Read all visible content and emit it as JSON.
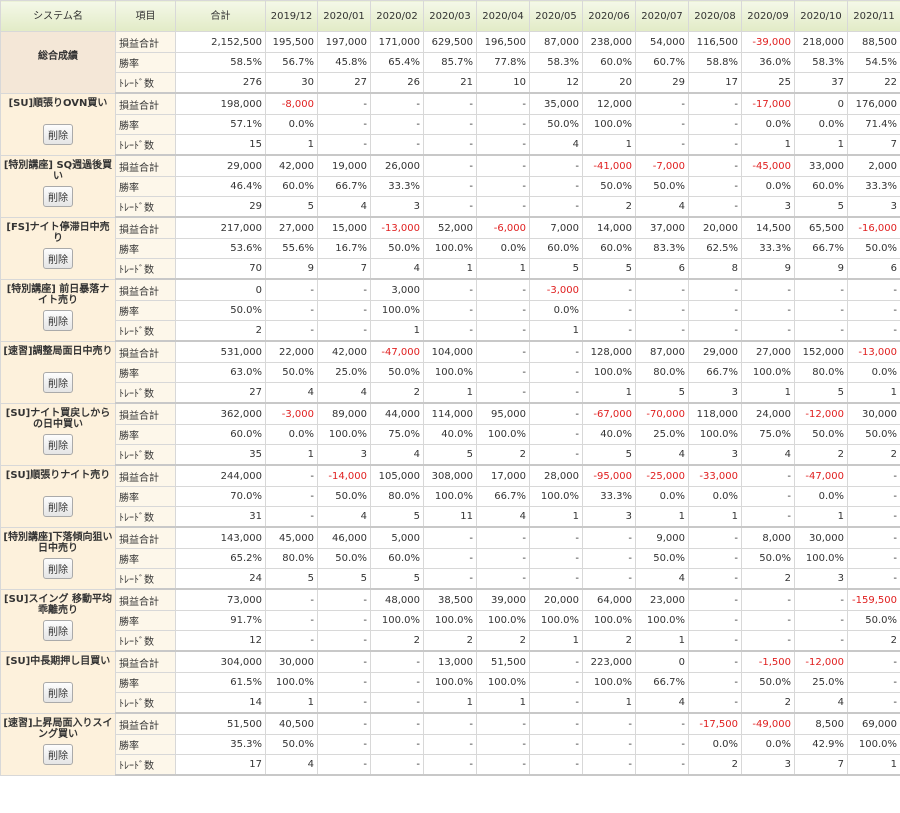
{
  "header": {
    "system": "システム名",
    "item": "項目",
    "total": "合計",
    "months": [
      "2019/12",
      "2020/01",
      "2020/02",
      "2020/03",
      "2020/04",
      "2020/05",
      "2020/06",
      "2020/07",
      "2020/08",
      "2020/09",
      "2020/10",
      "2020/11"
    ]
  },
  "row_labels": [
    "損益合計",
    "勝率",
    "ﾄﾚｰﾄﾞ数"
  ],
  "delete_label": "削除",
  "groups": [
    {
      "name": "総合成績",
      "is_total": true,
      "profit": [
        "2,152,500",
        "195,500",
        "197,000",
        "171,000",
        "629,500",
        "196,500",
        "87,000",
        "238,000",
        "54,000",
        "116,500",
        "-39,000",
        "218,000",
        "88,500"
      ],
      "winrate": [
        "58.5%",
        "56.7%",
        "45.8%",
        "65.4%",
        "85.7%",
        "77.8%",
        "58.3%",
        "60.0%",
        "60.7%",
        "58.8%",
        "36.0%",
        "58.3%",
        "54.5%"
      ],
      "trades": [
        "276",
        "30",
        "27",
        "26",
        "21",
        "10",
        "12",
        "20",
        "29",
        "17",
        "25",
        "37",
        "22"
      ]
    },
    {
      "name": "[SU]順張りOVN買い",
      "profit": [
        "198,000",
        "-8,000",
        "-",
        "-",
        "-",
        "-",
        "35,000",
        "12,000",
        "-",
        "-",
        "-17,000",
        "0",
        "176,000"
      ],
      "winrate": [
        "57.1%",
        "0.0%",
        "-",
        "-",
        "-",
        "-",
        "50.0%",
        "100.0%",
        "-",
        "-",
        "0.0%",
        "0.0%",
        "71.4%"
      ],
      "trades": [
        "15",
        "1",
        "-",
        "-",
        "-",
        "-",
        "4",
        "1",
        "-",
        "-",
        "1",
        "1",
        "7"
      ]
    },
    {
      "name": "[特別講座] SQ週過後買い",
      "profit": [
        "29,000",
        "42,000",
        "19,000",
        "26,000",
        "-",
        "-",
        "-",
        "-41,000",
        "-7,000",
        "-",
        "-45,000",
        "33,000",
        "2,000"
      ],
      "winrate": [
        "46.4%",
        "60.0%",
        "66.7%",
        "33.3%",
        "-",
        "-",
        "-",
        "50.0%",
        "50.0%",
        "-",
        "0.0%",
        "60.0%",
        "33.3%"
      ],
      "trades": [
        "29",
        "5",
        "4",
        "3",
        "-",
        "-",
        "-",
        "2",
        "4",
        "-",
        "3",
        "5",
        "3"
      ]
    },
    {
      "name": "[FS]ナイト停滞日中売り",
      "profit": [
        "217,000",
        "27,000",
        "15,000",
        "-13,000",
        "52,000",
        "-6,000",
        "7,000",
        "14,000",
        "37,000",
        "20,000",
        "14,500",
        "65,500",
        "-16,000"
      ],
      "winrate": [
        "53.6%",
        "55.6%",
        "16.7%",
        "50.0%",
        "100.0%",
        "0.0%",
        "60.0%",
        "60.0%",
        "83.3%",
        "62.5%",
        "33.3%",
        "66.7%",
        "50.0%"
      ],
      "trades": [
        "70",
        "9",
        "7",
        "4",
        "1",
        "1",
        "5",
        "5",
        "6",
        "8",
        "9",
        "9",
        "6"
      ]
    },
    {
      "name": "[特別講座] 前日暴落ナイト売り",
      "profit": [
        "0",
        "-",
        "-",
        "3,000",
        "-",
        "-",
        "-3,000",
        "-",
        "-",
        "-",
        "-",
        "-",
        "-"
      ],
      "winrate": [
        "50.0%",
        "-",
        "-",
        "100.0%",
        "-",
        "-",
        "0.0%",
        "-",
        "-",
        "-",
        "-",
        "-",
        "-"
      ],
      "trades": [
        "2",
        "-",
        "-",
        "1",
        "-",
        "-",
        "1",
        "-",
        "-",
        "-",
        "-",
        "-",
        "-"
      ]
    },
    {
      "name": "[速習]調整局面日中売り",
      "profit": [
        "531,000",
        "22,000",
        "42,000",
        "-47,000",
        "104,000",
        "-",
        "-",
        "128,000",
        "87,000",
        "29,000",
        "27,000",
        "152,000",
        "-13,000"
      ],
      "winrate": [
        "63.0%",
        "50.0%",
        "25.0%",
        "50.0%",
        "100.0%",
        "-",
        "-",
        "100.0%",
        "80.0%",
        "66.7%",
        "100.0%",
        "80.0%",
        "0.0%"
      ],
      "trades": [
        "27",
        "4",
        "4",
        "2",
        "1",
        "-",
        "-",
        "1",
        "5",
        "3",
        "1",
        "5",
        "1"
      ]
    },
    {
      "name": "[SU]ナイト買戻しからの日中買い",
      "profit": [
        "362,000",
        "-3,000",
        "89,000",
        "44,000",
        "114,000",
        "95,000",
        "-",
        "-67,000",
        "-70,000",
        "118,000",
        "24,000",
        "-12,000",
        "30,000"
      ],
      "winrate": [
        "60.0%",
        "0.0%",
        "100.0%",
        "75.0%",
        "40.0%",
        "100.0%",
        "-",
        "40.0%",
        "25.0%",
        "100.0%",
        "75.0%",
        "50.0%",
        "50.0%"
      ],
      "trades": [
        "35",
        "1",
        "3",
        "4",
        "5",
        "2",
        "-",
        "5",
        "4",
        "3",
        "4",
        "2",
        "2"
      ]
    },
    {
      "name": "[SU]順張りナイト売り",
      "profit": [
        "244,000",
        "-",
        "-14,000",
        "105,000",
        "308,000",
        "17,000",
        "28,000",
        "-95,000",
        "-25,000",
        "-33,000",
        "-",
        "-47,000",
        "-"
      ],
      "winrate": [
        "70.0%",
        "-",
        "50.0%",
        "80.0%",
        "100.0%",
        "66.7%",
        "100.0%",
        "33.3%",
        "0.0%",
        "0.0%",
        "-",
        "0.0%",
        "-"
      ],
      "trades": [
        "31",
        "-",
        "4",
        "5",
        "11",
        "4",
        "1",
        "3",
        "1",
        "1",
        "-",
        "1",
        "-"
      ]
    },
    {
      "name": "[特別講座]下落傾向狙い日中売り",
      "profit": [
        "143,000",
        "45,000",
        "46,000",
        "5,000",
        "-",
        "-",
        "-",
        "-",
        "9,000",
        "-",
        "8,000",
        "30,000",
        "-"
      ],
      "winrate": [
        "65.2%",
        "80.0%",
        "50.0%",
        "60.0%",
        "-",
        "-",
        "-",
        "-",
        "50.0%",
        "-",
        "50.0%",
        "100.0%",
        "-"
      ],
      "trades": [
        "24",
        "5",
        "5",
        "5",
        "-",
        "-",
        "-",
        "-",
        "4",
        "-",
        "2",
        "3",
        "-"
      ]
    },
    {
      "name": "[SU]スイング 移動平均乖離売り",
      "profit": [
        "73,000",
        "-",
        "-",
        "48,000",
        "38,500",
        "39,000",
        "20,000",
        "64,000",
        "23,000",
        "-",
        "-",
        "-",
        "-159,500"
      ],
      "winrate": [
        "91.7%",
        "-",
        "-",
        "100.0%",
        "100.0%",
        "100.0%",
        "100.0%",
        "100.0%",
        "100.0%",
        "-",
        "-",
        "-",
        "50.0%"
      ],
      "trades": [
        "12",
        "-",
        "-",
        "2",
        "2",
        "2",
        "1",
        "2",
        "1",
        "-",
        "-",
        "-",
        "2"
      ]
    },
    {
      "name": "[SU]中長期押し目買い",
      "profit": [
        "304,000",
        "30,000",
        "-",
        "-",
        "13,000",
        "51,500",
        "-",
        "223,000",
        "0",
        "-",
        "-1,500",
        "-12,000",
        "-"
      ],
      "winrate": [
        "61.5%",
        "100.0%",
        "-",
        "-",
        "100.0%",
        "100.0%",
        "-",
        "100.0%",
        "66.7%",
        "-",
        "50.0%",
        "25.0%",
        "-"
      ],
      "trades": [
        "14",
        "1",
        "-",
        "-",
        "1",
        "1",
        "-",
        "1",
        "4",
        "-",
        "2",
        "4",
        "-"
      ]
    },
    {
      "name": "[速習]上昇局面入りスイング買い",
      "profit": [
        "51,500",
        "40,500",
        "-",
        "-",
        "-",
        "-",
        "-",
        "-",
        "-",
        "-17,500",
        "-49,000",
        "8,500",
        "69,000"
      ],
      "winrate": [
        "35.3%",
        "50.0%",
        "-",
        "-",
        "-",
        "-",
        "-",
        "-",
        "-",
        "0.0%",
        "0.0%",
        "42.9%",
        "100.0%"
      ],
      "trades": [
        "17",
        "4",
        "-",
        "-",
        "-",
        "-",
        "-",
        "-",
        "-",
        "2",
        "3",
        "7",
        "1"
      ]
    }
  ]
}
